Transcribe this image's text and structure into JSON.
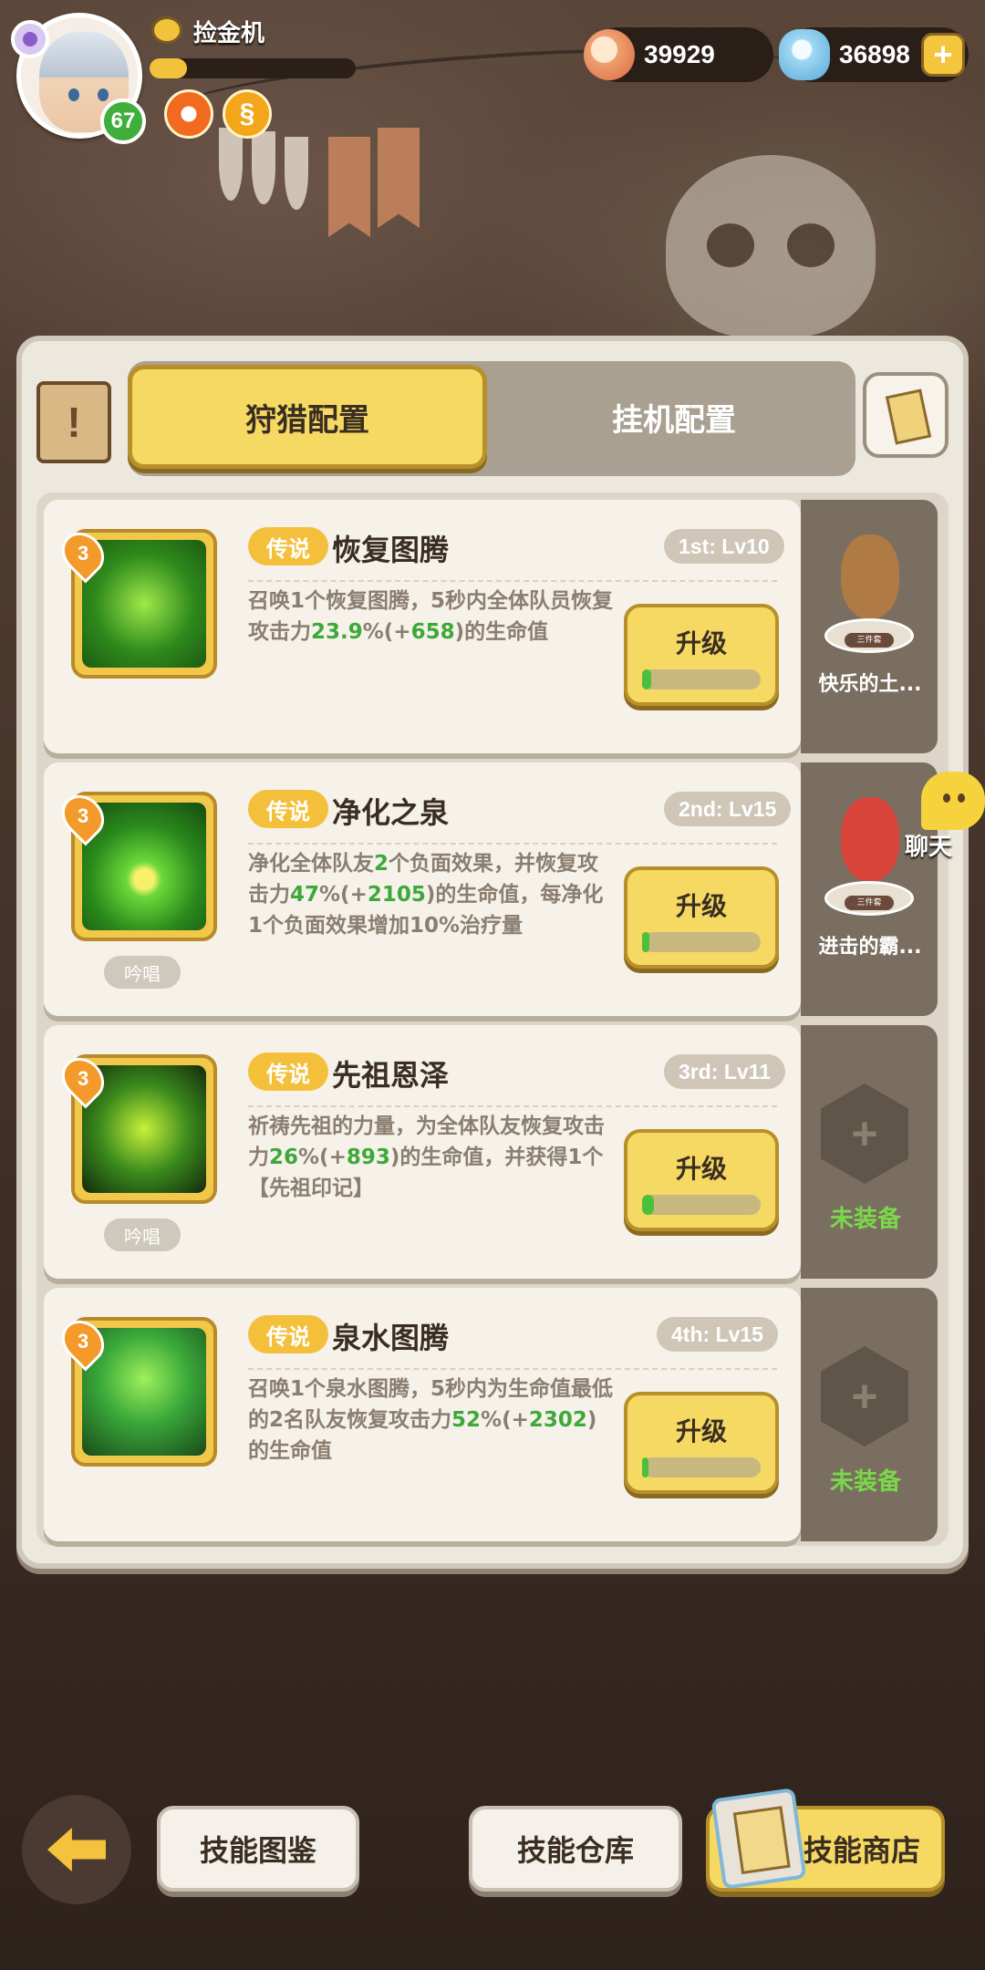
{
  "player": {
    "name": "捡金机",
    "level": "67",
    "xp_progress": 0.18
  },
  "currencies": [
    {
      "icon": "shell-icon",
      "value": "39929"
    },
    {
      "icon": "crystal-icon",
      "value": "36898"
    }
  ],
  "tabs": {
    "hunting": "狩猎配置",
    "idle": "挂机配置",
    "active": "hunting"
  },
  "skills": [
    {
      "rarity": "3",
      "tier": "传说",
      "name": "恢复图腾",
      "slot": "1st: Lv10",
      "desc_parts": [
        "召唤1个恢复图腾，5秒内全体队员恢复攻击力",
        "23.9",
        "%(+",
        "658",
        ")的生命值"
      ],
      "chant": "",
      "upgrade_label": "升级",
      "upgrade_progress": 0.08,
      "pet": {
        "name": "快乐的土...",
        "tag": "三件套",
        "icon": "monkey-pet-icon",
        "color": "#b07a44"
      }
    },
    {
      "rarity": "3",
      "tier": "传说",
      "name": "净化之泉",
      "slot": "2nd: Lv15",
      "desc_parts": [
        "净化全体队友",
        "2",
        "个负面效果，并恢复攻击力",
        "47",
        "%(+",
        "2105",
        ")的生命值，每净化1个负面效果增加10%治疗量"
      ],
      "chant": "吟唱",
      "upgrade_label": "升级",
      "upgrade_progress": 0.06,
      "pet": {
        "name": "进击的霸...",
        "tag": "三件套",
        "icon": "red-dino-pet-icon",
        "color": "#d8443a"
      }
    },
    {
      "rarity": "3",
      "tier": "传说",
      "name": "先祖恩泽",
      "slot": "3rd: Lv11",
      "desc_parts": [
        "祈祷先祖的力量，为全体队友恢复攻击力",
        "26",
        "%(+",
        "893",
        ")的生命值，并获得1个【先祖印记】"
      ],
      "chant": "吟唱",
      "upgrade_label": "升级",
      "upgrade_progress": 0.1,
      "pet": null,
      "empty_label": "未装备"
    },
    {
      "rarity": "3",
      "tier": "传说",
      "name": "泉水图腾",
      "slot": "4th: Lv15",
      "desc_parts": [
        "召唤1个泉水图腾，5秒内为生命值最低的2名队友恢复攻击力",
        "52",
        "%(+",
        "2302",
        ")的生命值"
      ],
      "chant": "",
      "upgrade_label": "升级",
      "upgrade_progress": 0.05,
      "pet": null,
      "empty_label": "未装备"
    }
  ],
  "chat": {
    "label": "聊天"
  },
  "bottom": {
    "codex": "技能图鉴",
    "warehouse": "技能仓库",
    "shop": "技能商店"
  },
  "colors": {
    "accent": "#f6d962",
    "highlight_green": "#3ea83a",
    "unequipped_green": "#7ad84a"
  }
}
